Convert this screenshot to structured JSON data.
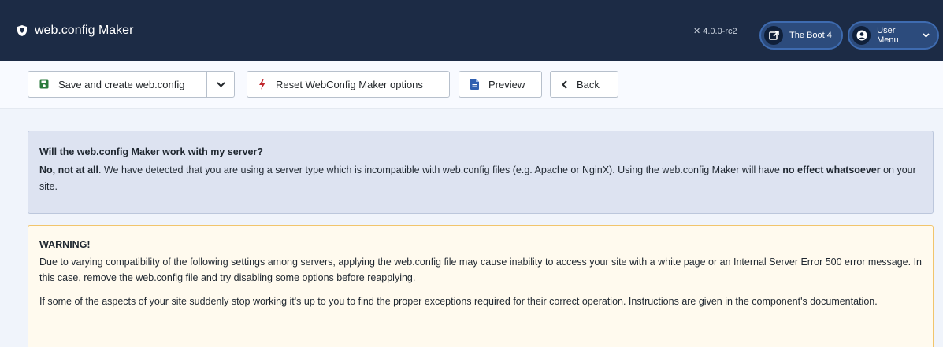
{
  "header": {
    "app_title": "web.config Maker",
    "version": "4.0.0-rc2",
    "site_label": "The Boot 4",
    "user_menu_label": "User Menu"
  },
  "toolbar": {
    "save_label": "Save and create web.config",
    "reset_label": "Reset WebConfig Maker options",
    "preview_label": "Preview",
    "back_label": "Back"
  },
  "info_alert": {
    "heading": "Will the web.config Maker work with my server?",
    "strong_lead": "No, not at all",
    "text_middle": ". We have detected that you are using a server type which is incompatible with web.config files (e.g. Apache or NginX). Using the web.config Maker will have ",
    "strong_tail": "no effect whatsoever",
    "text_end": " on your site."
  },
  "warning_alert": {
    "heading": "WARNING!",
    "paragraph1": "Due to varying compatibility of the following settings among servers, applying the web.config file may cause inability to access your site with a white page or an Internal Server Error 500 error message. In this case, remove the web.config file and try disabling some options before reapplying.",
    "paragraph2": "If some of the aspects of your site suddenly stop working it's up to you to find the proper exceptions required for their correct operation. Instructions are given in the component's documentation."
  },
  "colors": {
    "header_bg": "#1c2b45",
    "pill_bg": "#2c4b7c",
    "info_bg": "#dde3f1",
    "warning_bg": "#fffaee",
    "warning_border": "#f1c56c",
    "save_icon": "#2a7a3b",
    "reset_icon": "#c0282d",
    "preview_icon": "#2f5fb0"
  },
  "icons": {
    "brand": "shield-icon",
    "version": "joomla-icon",
    "site": "external-link-icon",
    "user": "user-circle-icon",
    "save": "save-icon",
    "dropdown": "chevron-down-icon",
    "reset": "bolt-icon",
    "preview": "file-icon",
    "back": "chevron-left-icon"
  }
}
